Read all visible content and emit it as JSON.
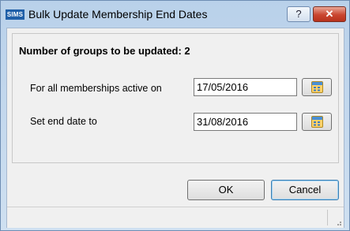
{
  "window": {
    "title": "Bulk Update Membership End Dates",
    "app_icon_text": "SIMS",
    "help_glyph": "?",
    "close_glyph": "✕"
  },
  "panel": {
    "heading": "Number of groups to be updated: 2",
    "active_label": "For all memberships active on",
    "active_date": "17/05/2016",
    "end_label": "Set end date to",
    "end_date": "31/08/2016"
  },
  "buttons": {
    "ok": "OK",
    "cancel": "Cancel"
  },
  "colors": {
    "titlebar": "#b9d1ea",
    "close_button": "#c9452f",
    "app_icon": "#1f5fa8"
  },
  "icons": {
    "calendar": "calendar-icon",
    "help": "help-icon",
    "close": "close-icon",
    "app": "sims-logo-icon",
    "grip": "resize-grip-icon"
  }
}
